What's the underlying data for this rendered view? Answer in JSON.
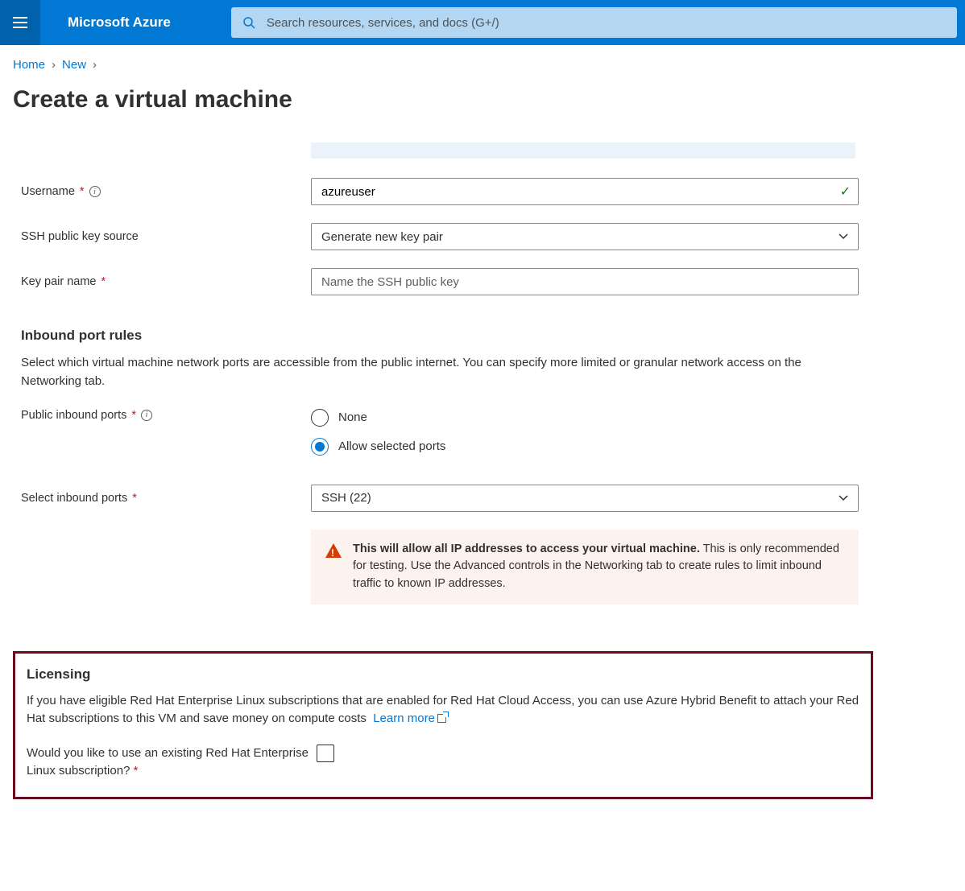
{
  "header": {
    "brand": "Microsoft Azure",
    "search_placeholder": "Search resources, services, and docs (G+/)"
  },
  "breadcrumb": [
    {
      "label": "Home"
    },
    {
      "label": "New"
    }
  ],
  "page_title": "Create a virtual machine",
  "form": {
    "username_label": "Username",
    "username_value": "azureuser",
    "ssh_source_label": "SSH public key source",
    "ssh_source_value": "Generate new key pair",
    "keypair_label": "Key pair name",
    "keypair_placeholder": "Name the SSH public key"
  },
  "inbound": {
    "title": "Inbound port rules",
    "desc": "Select which virtual machine network ports are accessible from the public internet. You can specify more limited or granular network access on the Networking tab.",
    "public_label": "Public inbound ports",
    "option_none": "None",
    "option_allow": "Allow selected ports",
    "select_label": "Select inbound ports",
    "select_value": "SSH (22)",
    "warning_bold": "This will allow all IP addresses to access your virtual machine.",
    "warning_rest": " This is only recommended for testing.  Use the Advanced controls in the Networking tab to create rules to limit inbound traffic to known IP addresses."
  },
  "licensing": {
    "title": "Licensing",
    "desc": "If you have eligible Red Hat Enterprise Linux subscriptions that are enabled for Red Hat Cloud Access, you can use Azure Hybrid Benefit to attach your Red Hat subscriptions to this VM and save money on compute costs",
    "learn_more": "Learn more",
    "question": "Would you like to use an existing Red Hat Enterprise Linux subscription?"
  }
}
